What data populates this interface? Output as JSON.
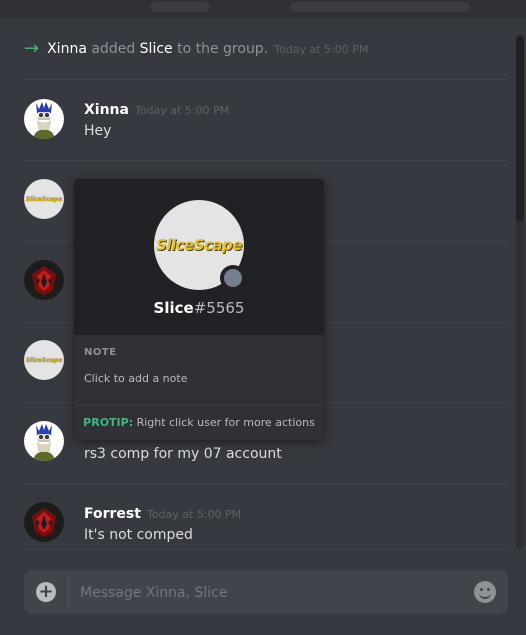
{
  "system_message": {
    "actor": "Xinna",
    "verb": " added ",
    "target": "Slice",
    "suffix": " to the group.",
    "timestamp": "Today at 5:00 PM"
  },
  "messages": [
    {
      "author": "Xinna",
      "timestamp": "Today at 5:00 PM",
      "text": "Hey"
    },
    {
      "author": "",
      "timestamp": "",
      "text": "rs3 comp for my 07 account"
    },
    {
      "author": "Forrest",
      "timestamp": "Today at 5:00 PM",
      "text": "It's not comped"
    }
  ],
  "profile_popout": {
    "avatar_text": "SliceScape",
    "username": "Slice",
    "discriminator": "#5565",
    "note_label": "NOTE",
    "note_placeholder": "Click to add a note",
    "protip_label": "PROTIP:",
    "protip_text": " Right click user for more actions",
    "status": "offline"
  },
  "composer": {
    "placeholder": "Message Xinna, Slice"
  },
  "icons": {
    "system_arrow": "arrow-right-icon",
    "attach": "plus-circle-icon",
    "emoji": "emoji-smile-icon"
  },
  "colors": {
    "background": "#36393f",
    "accent_green": "#43b581",
    "popout_header": "#202225",
    "status_offline": "#747f8d"
  }
}
